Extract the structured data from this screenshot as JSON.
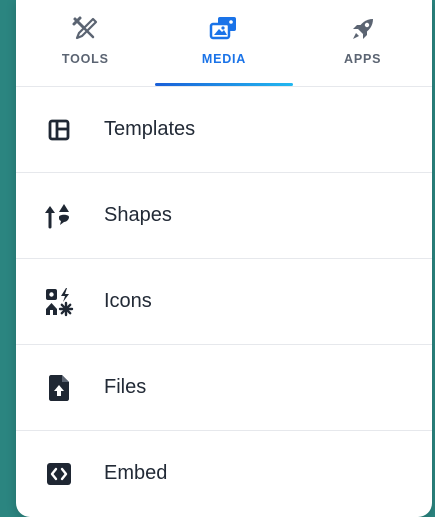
{
  "tabs": [
    {
      "label": "TOOLS",
      "icon": "tools-icon",
      "active": false
    },
    {
      "label": "MEDIA",
      "icon": "media-icon",
      "active": true
    },
    {
      "label": "APPS",
      "icon": "rocket-icon",
      "active": false
    }
  ],
  "menu": [
    {
      "label": "Templates",
      "icon": "templates-icon"
    },
    {
      "label": "Shapes",
      "icon": "shapes-icon"
    },
    {
      "label": "Icons",
      "icon": "icons-icon"
    },
    {
      "label": "Files",
      "icon": "file-upload-icon"
    },
    {
      "label": "Embed",
      "icon": "embed-code-icon"
    }
  ],
  "colors": {
    "accent": "#1a73e8",
    "icon_dark": "#1f2733",
    "background": "#2b8580"
  }
}
